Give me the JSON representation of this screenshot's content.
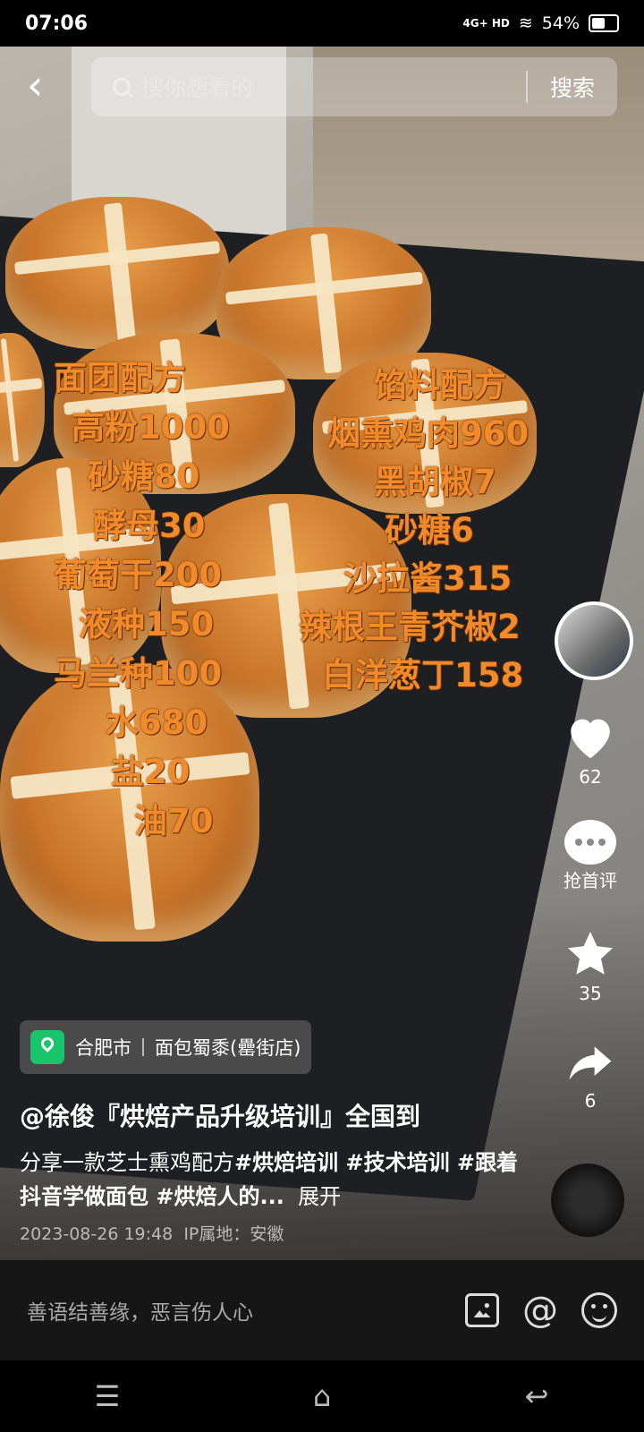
{
  "status_bar": {
    "time": "07:06",
    "network": "4G+ HD",
    "battery": "54%"
  },
  "search": {
    "placeholder": "搜你想看的",
    "button": "搜索"
  },
  "overlay": {
    "left_lines": [
      "面团配方",
      "高粉1000",
      "砂糖80",
      "酵母30",
      "葡萄干200",
      "液种150",
      "马兰种100",
      "水680",
      "盐20",
      "油70"
    ],
    "right_lines": [
      "馅料配方",
      "烟熏鸡肉960",
      "黑胡椒7",
      "砂糖6",
      "沙拉酱315",
      "辣根王青芥椒2",
      "白洋葱丁158"
    ]
  },
  "sidebar": {
    "likes": "62",
    "comment_label": "抢首评",
    "favorites": "35",
    "shares": "6"
  },
  "location": {
    "city": "合肥市",
    "shop": "面包蜀黍(罍街店)"
  },
  "post": {
    "author": "@徐俊『烘焙产品升级培训』全国到",
    "desc_prefix": "分享一款芝士熏鸡配方",
    "tags": [
      "#烘焙培训",
      " #技术培训",
      " #跟着抖音学做面包",
      " #烘焙人的..."
    ],
    "expand": "展开",
    "date": "2023-08-26 19:48",
    "ip": "IP属地：安徽"
  },
  "comment_bar": {
    "placeholder": "善语结善缘，恶言伤人心"
  },
  "navbar": {
    "menu": "☰",
    "home": "⌂",
    "back": "↩"
  }
}
